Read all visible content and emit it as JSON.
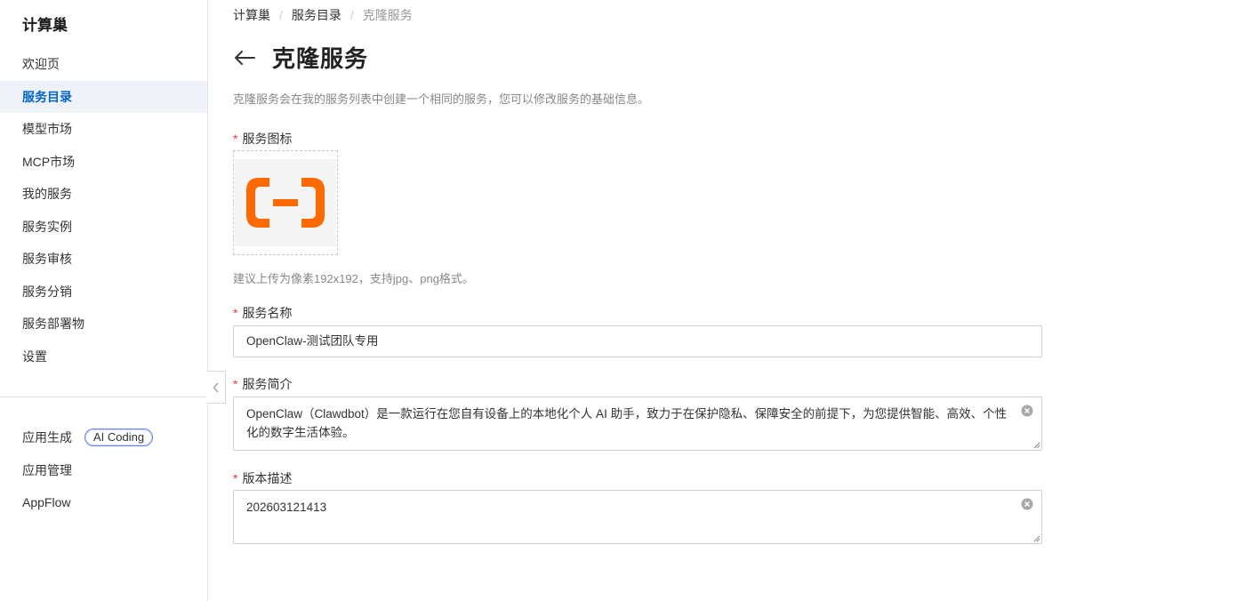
{
  "sidebar": {
    "title": "计算巢",
    "items": [
      {
        "label": "欢迎页"
      },
      {
        "label": "服务目录"
      },
      {
        "label": "模型市场"
      },
      {
        "label": "MCP市场"
      },
      {
        "label": "我的服务"
      },
      {
        "label": "服务实例"
      },
      {
        "label": "服务审核"
      },
      {
        "label": "服务分销"
      },
      {
        "label": "服务部署物"
      },
      {
        "label": "设置"
      }
    ],
    "active": "服务目录",
    "secondary": [
      {
        "label": "应用生成",
        "badge": "AI Coding"
      },
      {
        "label": "应用管理"
      },
      {
        "label": "AppFlow"
      }
    ]
  },
  "breadcrumb": [
    "计算巢",
    "服务目录",
    "克隆服务"
  ],
  "page": {
    "title": "克隆服务",
    "description": "克隆服务会在我的服务列表中创建一个相同的服务，您可以修改服务的基础信息。"
  },
  "form": {
    "required_mark": "*",
    "icon_label": "服务图标",
    "icon_hint": "建议上传为像素192x192，支持jpg、png格式。",
    "name_label": "服务名称",
    "name_value": "OpenClaw-测试团队专用",
    "summary_label": "服务简介",
    "summary_value": "OpenClaw（Clawdbot）是一款运行在您自有设备上的本地化个人 AI 助手，致力于在保护隐私、保障安全的前提下，为您提供智能、高效、个性化的数字生活体验。",
    "version_label": "版本描述",
    "version_value": "202603121413"
  },
  "colors": {
    "accent": "#0064c8",
    "logo_orange": "#ff6a00",
    "required": "#e4393c"
  }
}
